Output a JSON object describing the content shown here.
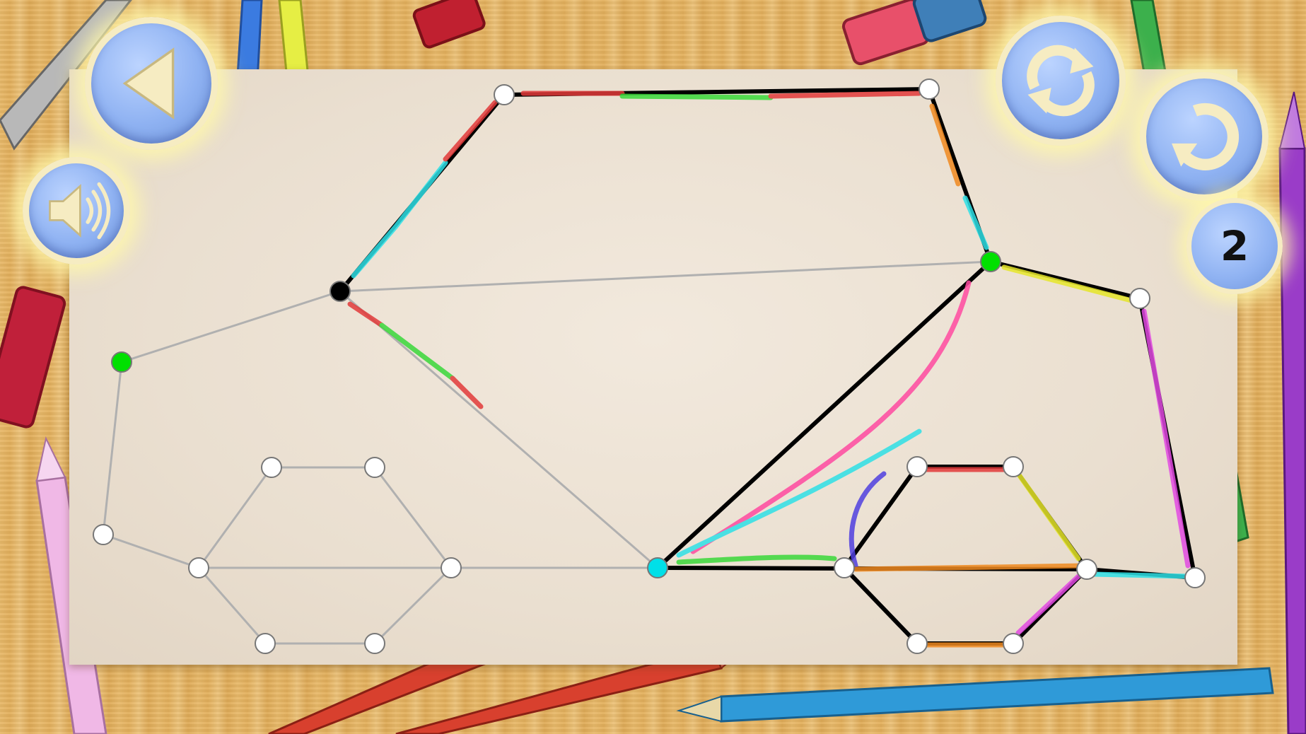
{
  "game": {
    "level": "2"
  },
  "controls": {
    "back": {
      "icon": "back-triangle-icon"
    },
    "sound": {
      "icon": "speaker-icon"
    },
    "restart": {
      "icon": "restart-arrows-icon"
    },
    "undo": {
      "icon": "undo-arrow-icon"
    }
  },
  "colors": {
    "drawn_line": "#000000",
    "hint_line": "#b0b0b0",
    "node_default": "#ffffff",
    "node_start": "#00e000",
    "node_current": "#00e0e8",
    "node_pen": "#000000",
    "button_blue": "#8fb2f2",
    "button_glow": "#fff8aa"
  }
}
